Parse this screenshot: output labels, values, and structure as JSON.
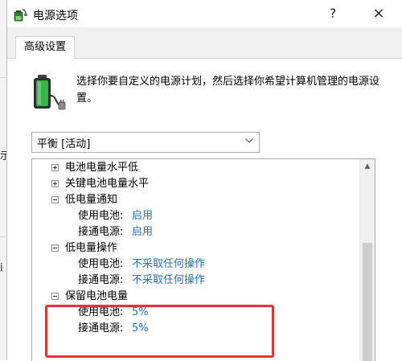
{
  "background_window": {
    "fragments": [
      "示",
      "i"
    ]
  },
  "dialog": {
    "title": "电源选项",
    "help_label": "?",
    "close_label": "×",
    "tab_label": "高级设置",
    "description": "选择你要自定义的电源计划，然后选择你希望计算机管理的电源设置。",
    "plan_value": "平衡 [活动]"
  },
  "tree": {
    "items": [
      {
        "type": "group",
        "state": "collapsed",
        "name": "电池电量水平低"
      },
      {
        "type": "group",
        "state": "collapsed",
        "name": "关键电池电量水平"
      },
      {
        "type": "group",
        "state": "expanded",
        "name": "低电量通知"
      },
      {
        "type": "setting",
        "label": "使用电池:",
        "value": "启用"
      },
      {
        "type": "setting",
        "label": "接通电源:",
        "value": "启用"
      },
      {
        "type": "group",
        "state": "expanded",
        "name": "低电量操作"
      },
      {
        "type": "setting",
        "label": "使用电池:",
        "value": "不采取任何操作"
      },
      {
        "type": "setting",
        "label": "接通电源:",
        "value": "不采取任何操作"
      },
      {
        "type": "group",
        "state": "expanded",
        "name": "保留电池电量"
      },
      {
        "type": "setting",
        "label": "使用电池:",
        "value": "5%"
      },
      {
        "type": "setting",
        "label": "接通电源:",
        "value": "5%"
      }
    ]
  },
  "colors": {
    "link_value": "#2a6cb5",
    "highlight_border": "#e23535",
    "battery_green": "#3bb54a"
  },
  "icons": {
    "app": "power-options-icon",
    "battery": "battery-plug-icon",
    "dropdown": "chevron-down-icon",
    "scroll_up": "scroll-up-arrow-icon"
  }
}
